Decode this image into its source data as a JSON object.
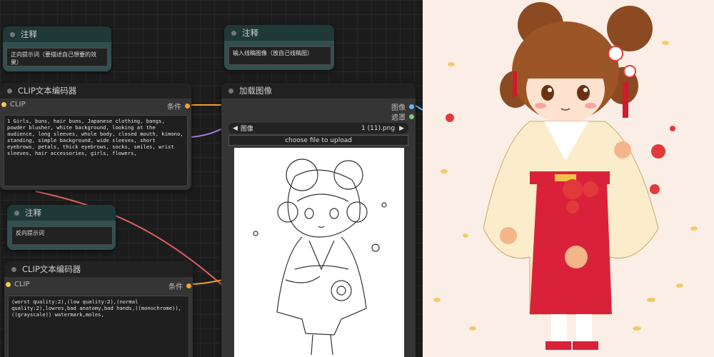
{
  "canvas": {
    "note1": {
      "title": "注释",
      "text": "正向提示词（要描述自己想要的效果）"
    },
    "note2": {
      "title": "注释",
      "text": "输入线稿图像（放自己线稿图）"
    },
    "note3": {
      "title": "注释",
      "text": "反向提示词"
    },
    "clip1": {
      "title": "CLIP文本编码器",
      "input": "CLIP",
      "output": "条件",
      "prompt": "1 Girls, buns, hair buns, Japanese clothing, bangs, powder blusher, white background, looking at the audience, long sleeves, whole body, closed mouth, kimono, standing, simple background, wide sleeves, short eyebrows, petals, thick eyebrows, socks, smiles, wrist sleeves, hair accessories, girls, flowers,"
    },
    "clip2": {
      "title": "CLIP文本编码器",
      "input": "CLIP",
      "output": "条件",
      "prompt": "(worst quality:2),(low quality:2),(normal quality:2),lowres,bad anatomy,bad hands,((monochrome)),((grayscale)) watermark,moles,"
    },
    "load": {
      "title": "加载图像",
      "out_image": "图像",
      "out_mask": "遮罩",
      "image_label": "图像",
      "image_value": "1 (11).png",
      "upload_label": "choose file to upload",
      "arrow_left": "◀",
      "arrow_right": "▶"
    }
  },
  "colors": {
    "note_bg": "#335050",
    "node_bg": "#353535",
    "link_yellow": "#f0a030",
    "link_red": "#e06060",
    "link_purple": "#a080e0",
    "clip_dot": "#f5c84a",
    "cond_dot": "#f5a030",
    "image_dot": "#64b5f6",
    "mask_dot": "#81c784"
  }
}
